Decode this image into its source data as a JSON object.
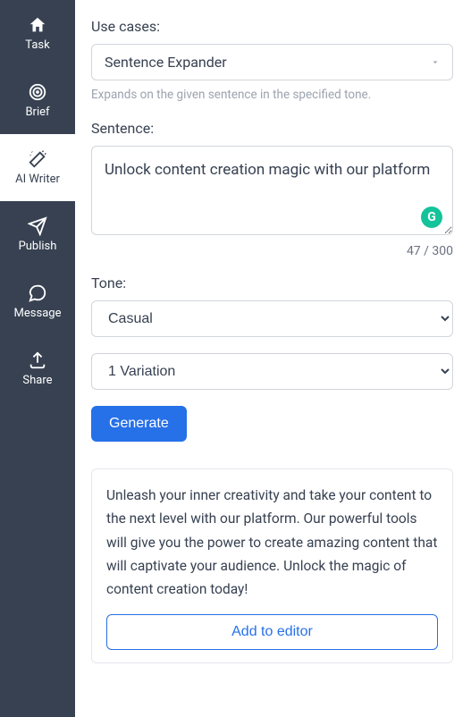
{
  "sidebar": {
    "items": [
      {
        "label": "Task",
        "icon": "home"
      },
      {
        "label": "Brief",
        "icon": "target"
      },
      {
        "label": "AI Writer",
        "icon": "wand"
      },
      {
        "label": "Publish",
        "icon": "send"
      },
      {
        "label": "Message",
        "icon": "chat"
      },
      {
        "label": "Share",
        "icon": "upload"
      }
    ]
  },
  "form": {
    "use_cases_label": "Use cases:",
    "use_case_selected": "Sentence Expander",
    "use_case_hint": "Expands on the given sentence in the specified tone.",
    "sentence_label": "Sentence:",
    "sentence_value": "Unlock content creation magic with our platform",
    "char_count": "47 / 300",
    "tone_label": "Tone:",
    "tone_selected": "Casual",
    "variation_selected": "1 Variation",
    "generate_label": "Generate"
  },
  "result": {
    "text": "Unleash your inner creativity and take your content to the next level with our platform. Our powerful tools will give you the power to create amazing content that will captivate your audience. Unlock the magic of content creation today!",
    "add_to_editor_label": "Add to editor"
  }
}
